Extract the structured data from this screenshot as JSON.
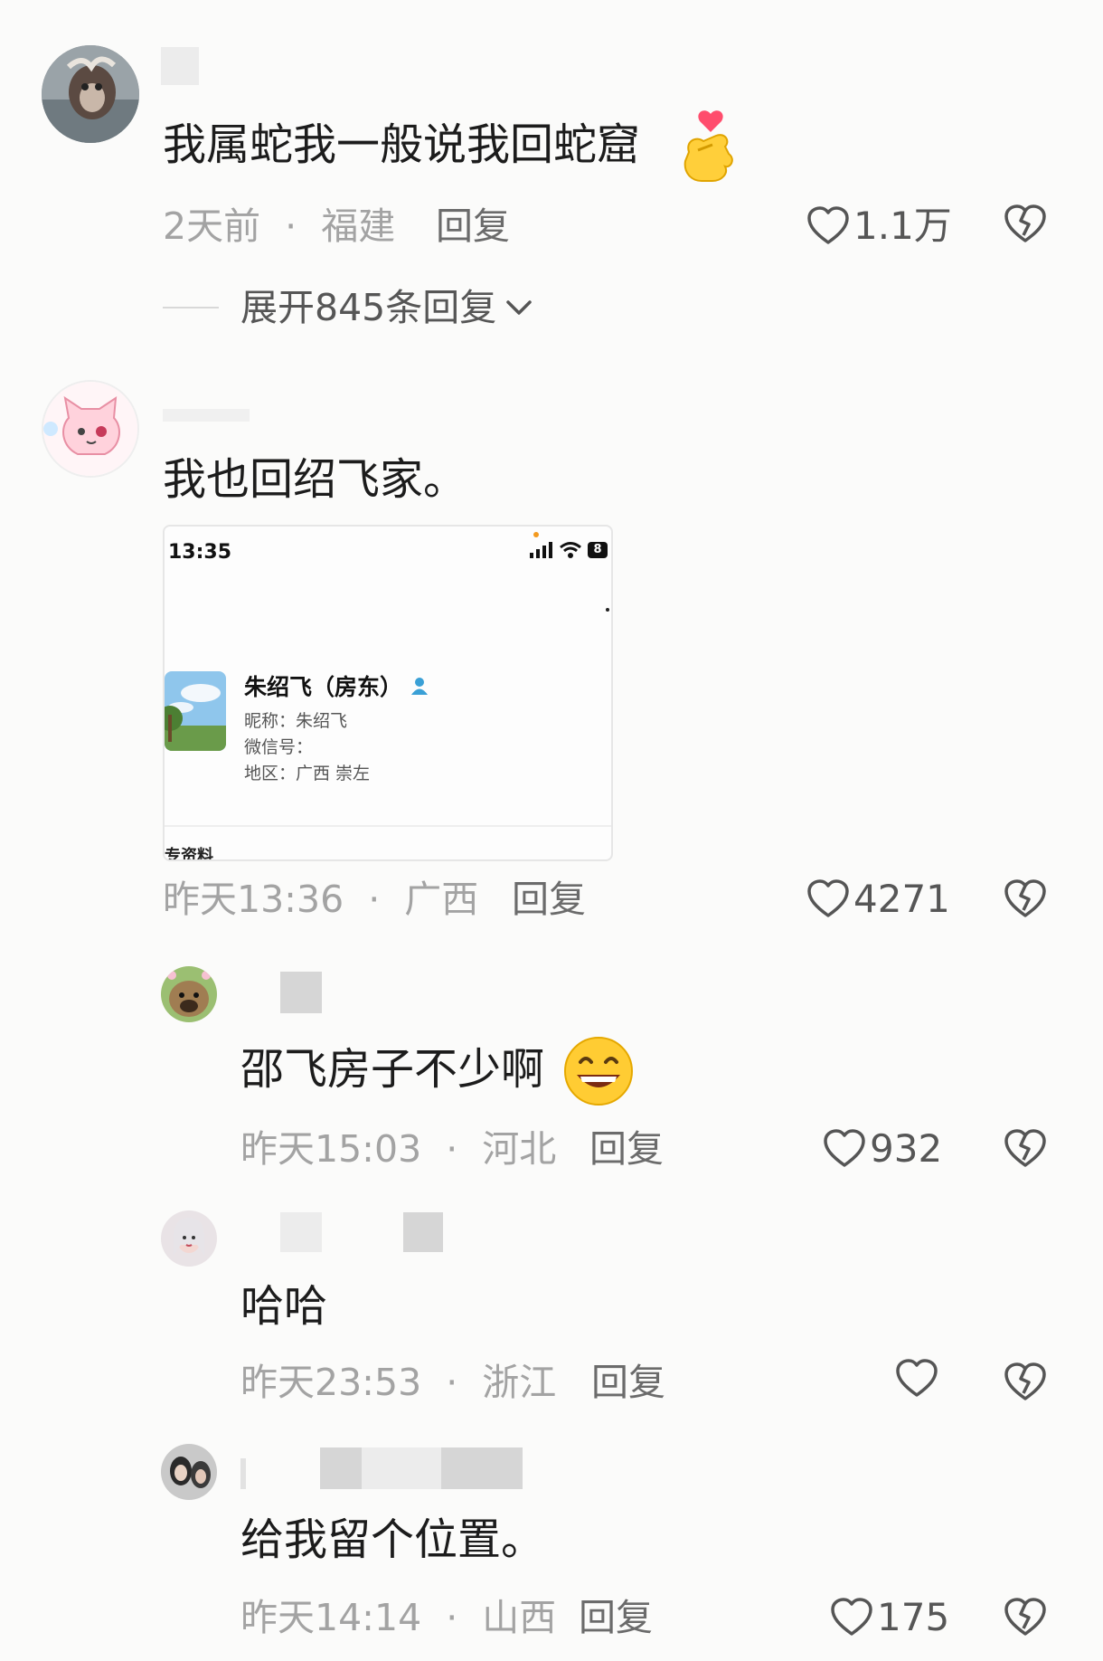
{
  "comments": [
    {
      "text": "我属蛇我一般说我回蛇窟",
      "time": "2天前",
      "location": "福建",
      "reply_label": "回复",
      "likes": "1.1万",
      "expand_label": "展开845条回复"
    },
    {
      "text": "我也回绍飞家。",
      "time": "昨天13:36",
      "location": "广西",
      "reply_label": "回复",
      "likes": "4271",
      "screenshot": {
        "time": "13:35",
        "battery": "8",
        "contact_name": "朱绍飞（房东）",
        "nickname": "昵称：朱绍飞",
        "wechat_id": "微信号：",
        "region": "地区：广西 崇左",
        "footer": "专资料"
      }
    }
  ],
  "replies": [
    {
      "text": "邵飞房子不少啊",
      "time": "昨天15:03",
      "location": "河北",
      "reply_label": "回复",
      "likes": "932"
    },
    {
      "text": "哈哈",
      "time": "昨天23:53",
      "location": "浙江",
      "reply_label": "回复",
      "likes": ""
    },
    {
      "text": "给我留个位置。",
      "time": "昨天14:14",
      "location": "山西",
      "reply_label": "回复",
      "likes": "175"
    }
  ],
  "separator": "·",
  "colors": {
    "background": "#fbfbfa",
    "text": "#1c1c1c",
    "meta": "#a3a3a3",
    "reply": "#6b6b6b",
    "verified": "#3aa0d6"
  },
  "icons": [
    "heart-icon",
    "broken-heart-icon",
    "chevron-down-icon",
    "finger-heart-emoji",
    "grinning-emoji",
    "person-icon",
    "signal-icon",
    "wifi-icon",
    "battery-icon"
  ]
}
